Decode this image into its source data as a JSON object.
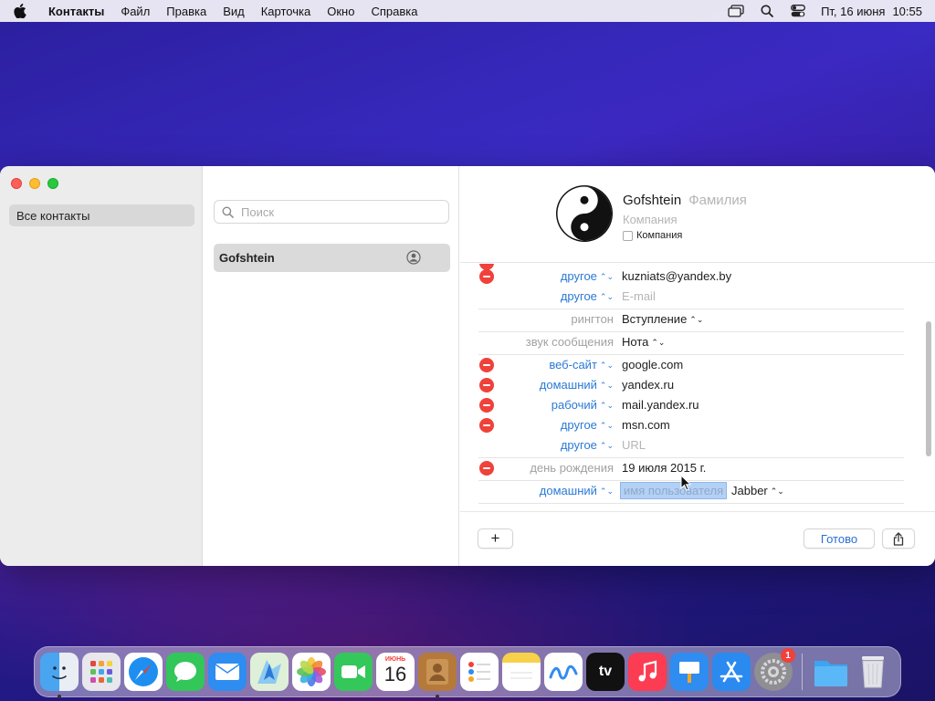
{
  "menubar": {
    "app_name": "Контакты",
    "items": [
      "Файл",
      "Правка",
      "Вид",
      "Карточка",
      "Окно",
      "Справка"
    ],
    "date": "Пт, 16 июня",
    "time": "10:55"
  },
  "sidebar": {
    "group": "Все контакты"
  },
  "list": {
    "search_placeholder": "Поиск",
    "contact_name": "Gofshtein"
  },
  "card": {
    "first_name": "Gofshtein",
    "last_name_placeholder": "Фамилия",
    "company_placeholder": "Компания",
    "company_checkbox_label": "Компания",
    "fields": [
      {
        "label": "другое",
        "value": "kuzniats@yandex.by",
        "removable": true,
        "chevron": true,
        "placeholder": false
      },
      {
        "label": "другое",
        "value": "E-mail",
        "removable": false,
        "chevron": true,
        "placeholder": true
      },
      {
        "label": "рингтон",
        "value": "Вступление",
        "removable": false,
        "chevron": false,
        "placeholder": false,
        "gray": true
      },
      {
        "label": "звук сообщения",
        "value": "Нота",
        "removable": false,
        "chevron": false,
        "placeholder": false,
        "gray": true
      },
      {
        "label": "веб-сайт",
        "value": "google.com",
        "removable": true,
        "chevron": true,
        "placeholder": false
      },
      {
        "label": "домашний",
        "value": "yandex.ru",
        "removable": true,
        "chevron": true,
        "placeholder": false
      },
      {
        "label": "рабочий",
        "value": "mail.yandex.ru",
        "removable": true,
        "chevron": true,
        "placeholder": false
      },
      {
        "label": "другое",
        "value": "msn.com",
        "removable": true,
        "chevron": true,
        "placeholder": false
      },
      {
        "label": "другое",
        "value": "URL",
        "removable": false,
        "chevron": true,
        "placeholder": true
      },
      {
        "label": "день рождения",
        "value": "19 июля 2015 г.",
        "removable": true,
        "chevron": false,
        "placeholder": false,
        "gray": true
      },
      {
        "label": "домашний",
        "value": "имя пользователя",
        "service": "Jabber",
        "removable": false,
        "chevron": true,
        "placeholder": true
      }
    ],
    "done_label": "Готово",
    "add_label": "+"
  },
  "dock": {
    "calendar_month": "ИЮНЬ",
    "calendar_day": "16",
    "tv_label": "tv",
    "settings_badge": "1"
  },
  "colors": {
    "accent": "#2a7ad6",
    "remove": "#f0413b",
    "selection": "#b3d1f5"
  }
}
